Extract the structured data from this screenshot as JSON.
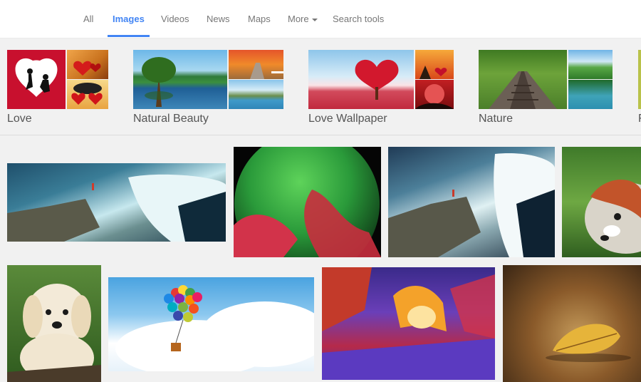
{
  "tabs": [
    {
      "label": "All",
      "active": false
    },
    {
      "label": "Images",
      "active": true
    },
    {
      "label": "Videos",
      "active": false
    },
    {
      "label": "News",
      "active": false
    },
    {
      "label": "Maps",
      "active": false
    },
    {
      "label": "More",
      "active": false,
      "dropdown": true
    },
    {
      "label": "Search tools",
      "active": false
    }
  ],
  "related": [
    {
      "label": "Love"
    },
    {
      "label": "Natural Beauty"
    },
    {
      "label": "Love Wallpaper"
    },
    {
      "label": "Nature"
    },
    {
      "label": "F"
    }
  ],
  "colors": {
    "accent": "#4285f4",
    "tab_text": "#777777",
    "background": "#f1f1f1"
  }
}
